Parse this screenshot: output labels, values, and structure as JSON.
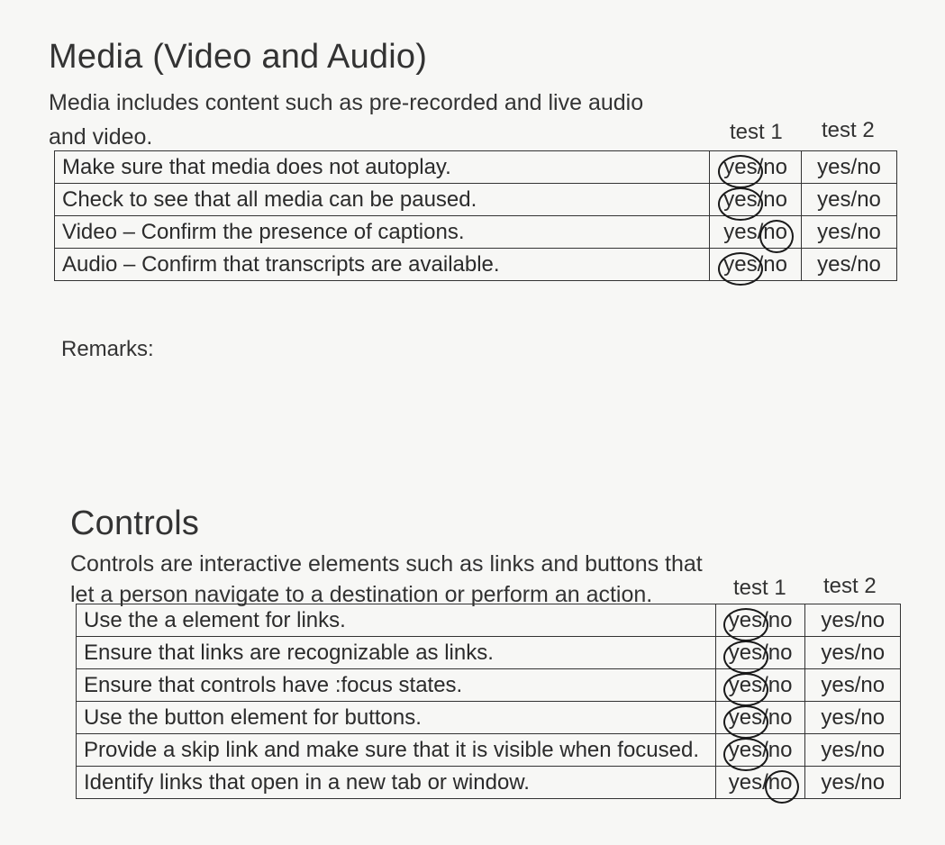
{
  "media": {
    "title": "Media (Video and Audio)",
    "intro_line1": "Media includes content such as pre-recorded and live audio",
    "intro_line2": "and video.",
    "test1": "test 1",
    "test2": "test 2",
    "rows": [
      {
        "label": "Make sure that media does not autoplay.",
        "t1": "yes/no",
        "t2": "yes/no",
        "circled": "yes"
      },
      {
        "label": "Check to see that all media can be paused.",
        "t1": "yes/no",
        "t2": "yes/no",
        "circled": "yes"
      },
      {
        "label": "Video – Confirm the presence of captions.",
        "t1": "yes/no",
        "t2": "yes/no",
        "circled": "no"
      },
      {
        "label": "Audio – Confirm that transcripts are available.",
        "t1": "yes/no",
        "t2": "yes/no",
        "circled": "yes"
      }
    ],
    "remarks": "Remarks:"
  },
  "controls": {
    "title": "Controls",
    "intro_line1": "Controls are interactive elements such as links and buttons that",
    "intro_line2": "let a person navigate to a destination or perform an action.",
    "test1": "test 1",
    "test2": "test 2",
    "rows": [
      {
        "label": "Use the a element for links.",
        "t1": "yes/no",
        "t2": "yes/no",
        "circled": "yes"
      },
      {
        "label": "Ensure that links are recognizable as links.",
        "t1": "yes/no",
        "t2": "yes/no",
        "circled": "yes"
      },
      {
        "label": "Ensure that controls have :focus states.",
        "t1": "yes/no",
        "t2": "yes/no",
        "circled": "yes"
      },
      {
        "label": "Use the button element for buttons.",
        "t1": "yes/no",
        "t2": "yes/no",
        "circled": "yes"
      },
      {
        "label": "Provide a skip link and make sure that it is visible when focused.",
        "t1": "yes/no",
        "t2": "yes/no",
        "circled": "yes"
      },
      {
        "label": "Identify links that open in a new tab or window.",
        "t1": "yes/no",
        "t2": "yes/no",
        "circled": "no"
      }
    ]
  }
}
